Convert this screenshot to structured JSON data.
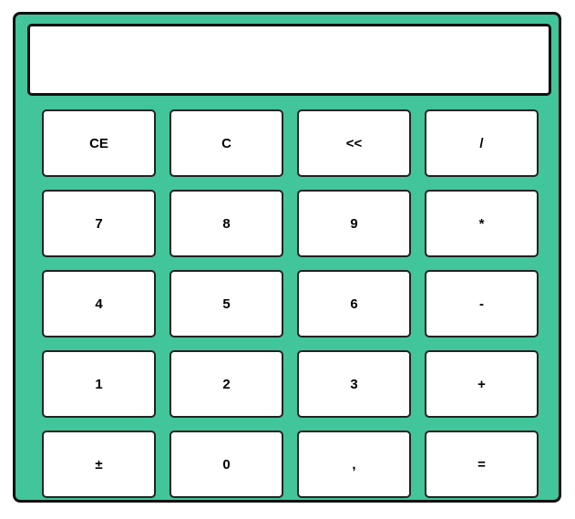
{
  "display": {
    "value": ""
  },
  "keys": {
    "ce": "CE",
    "c": "C",
    "backspace": "<<",
    "divide": "/",
    "seven": "7",
    "eight": "8",
    "nine": "9",
    "multiply": "*",
    "four": "4",
    "five": "5",
    "six": "6",
    "minus": "-",
    "one": "1",
    "two": "2",
    "three": "3",
    "plus": "+",
    "plus_minus": "±",
    "zero": "0",
    "comma": ",",
    "equals": "="
  },
  "colors": {
    "body": "#42c59a",
    "key_background": "#ffffff",
    "border": "#111111"
  }
}
